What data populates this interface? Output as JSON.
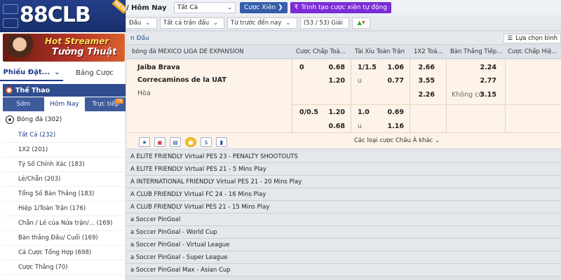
{
  "brand": {
    "logo": "88CLB",
    "new_badge": "NEW"
  },
  "banner": {
    "line1": "Hot Streamer",
    "line2": "Tường Thuật"
  },
  "sidebar": {
    "bet_tabs": [
      {
        "label": "Phiếu Đặt..."
      },
      {
        "label": "Bảng Cược"
      }
    ],
    "sports_title": "Thể Thao",
    "time_tabs": [
      {
        "label": "Sớm"
      },
      {
        "label": "Hôm Nay"
      },
      {
        "label": "Trực tiếp"
      }
    ],
    "live_count": "76",
    "soccer": "Bóng đá  (302)",
    "menu": [
      "Tất Cả  (232)",
      "1X2  (201)",
      "Tỷ Số Chính Xác  (183)",
      "Lẻ/Chẵn  (203)",
      "Tổng Số Bàn Thắng  (183)",
      "Hiệp 1/Toàn Trận  (176)",
      "Chẵn / Lẻ của Nửa trận/...  (169)",
      "Bàn thắng Đầu/ Cuối  (169)",
      "Cá Cược Tổng Hợp  (698)",
      "Cược Thắng  (70)"
    ]
  },
  "topbar": {
    "crumb": "/ Hôm Nay",
    "select_value": "Tất Cả",
    "parlay_label": "Cược Xiên  ❯",
    "auto_label": "Trình tạo cược xiên tự động"
  },
  "filters": {
    "f1": "Đấu",
    "f2": "Tất cả trận đấu",
    "f3": "Từ trước đến nay",
    "f4": "(53 / 53) Giải"
  },
  "league_bar": {
    "title": "n Đấu",
    "pick_label": "Lựa chọn bình"
  },
  "table_header": {
    "league": "bóng đá MEXICO LIGA DE EXPANSION",
    "handicap": "Cược Chấp Toà...",
    "ou": "Tài Xỉu Toàn Trận",
    "x12": "1X2 Toà...",
    "goals": "Bàn Thắng Tiếp...",
    "handicap2": "Cược Chấp Hiệ..."
  },
  "match": {
    "home": "Jaiba Brava",
    "away": "Correcaminos de la UAT",
    "draw": "Hòa",
    "hdp1_line": "0",
    "hdp1_home": "0.68",
    "hdp1_away": "1.20",
    "ou1_line": "1/1.5",
    "ou1_over": "1.06",
    "ou1_u": "u",
    "ou1_under": "0.77",
    "x12_home": "2.66",
    "x12_away": "3.55",
    "x12_draw": "2.26",
    "ng_home": "2.24",
    "ng_away": "2.77",
    "ng_none_label": "Không có",
    "ng_none": "3.15",
    "hdp2_line": "0/0.5",
    "hdp2_home": "1.20",
    "hdp2_away": "0.68",
    "ou2_line": "1.0",
    "ou2_over": "0.69",
    "ou2_u": "u",
    "ou2_under": "1.16",
    "more_label": "Các loại cược Châu Á khác  ⌄"
  },
  "icons": [
    "star-icon",
    "tv-icon",
    "stats-icon",
    "live-icon",
    "dollar-icon",
    "chart-icon"
  ],
  "leagues": [
    "A ELITE FRIENDLY Virtual PES 23 - PENALTY SHOOTOUTS",
    "A ELITE FRIENDLY Virtual PES 21 - 5 Mins Play",
    "A INTERNATIONAL FRIENDLY Virtual PES 21 - 20 Mins Play",
    "A CLUB FRIENDLY Virtual FC 24 - 16 Mins Play",
    "A CLUB FRIENDLY Virtual PES 21 - 15 Mins Play",
    "a Soccer PinGoal",
    "a Soccer PinGoal - World Cup",
    "a Soccer PinGoal - Virtual League",
    "a Soccer PinGoal - Super League",
    "a Soccer PinGoal Max - Asian Cup"
  ]
}
